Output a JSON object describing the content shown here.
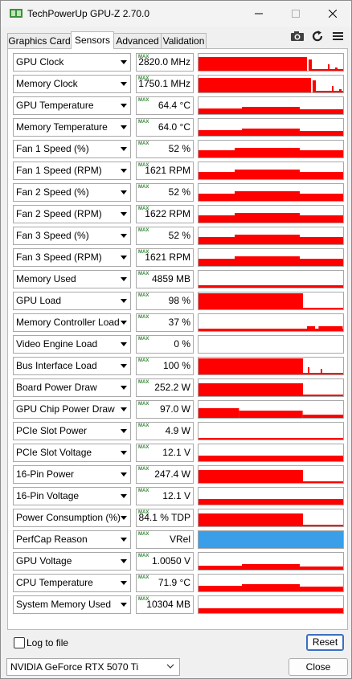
{
  "window": {
    "title": "TechPowerUp GPU-Z 2.70.0",
    "controls": {
      "minimize": "minimize-icon",
      "maximize": "maximize-icon",
      "close": "close-icon"
    }
  },
  "tabs": [
    {
      "label": "Graphics Card",
      "active": false
    },
    {
      "label": "Sensors",
      "active": true
    },
    {
      "label": "Advanced",
      "active": false
    },
    {
      "label": "Validation",
      "active": false
    }
  ],
  "toolbar": {
    "icons": [
      "camera-icon",
      "refresh-icon",
      "menu-icon"
    ]
  },
  "graph_color": "#ff0000",
  "perfcap_color": "#3a9ee8",
  "max_tag": "MAX",
  "sensors": [
    {
      "label": "GPU Clock",
      "value": "2820.0 MHz"
    },
    {
      "label": "Memory Clock",
      "value": "1750.1 MHz"
    },
    {
      "label": "GPU Temperature",
      "value": "64.4 °C"
    },
    {
      "label": "Memory Temperature",
      "value": "64.0 °C"
    },
    {
      "label": "Fan 1 Speed (%)",
      "value": "52 %"
    },
    {
      "label": "Fan 1 Speed (RPM)",
      "value": "1621 RPM"
    },
    {
      "label": "Fan 2 Speed (%)",
      "value": "52 %"
    },
    {
      "label": "Fan 2 Speed (RPM)",
      "value": "1622 RPM"
    },
    {
      "label": "Fan 3 Speed (%)",
      "value": "52 %"
    },
    {
      "label": "Fan 3 Speed (RPM)",
      "value": "1621 RPM"
    },
    {
      "label": "Memory Used",
      "value": "4859 MB"
    },
    {
      "label": "GPU Load",
      "value": "98 %"
    },
    {
      "label": "Memory Controller Load",
      "value": "37 %"
    },
    {
      "label": "Video Engine Load",
      "value": "0 %"
    },
    {
      "label": "Bus Interface Load",
      "value": "100 %"
    },
    {
      "label": "Board Power Draw",
      "value": "252.2 W"
    },
    {
      "label": "GPU Chip Power Draw",
      "value": "97.0 W"
    },
    {
      "label": "PCIe Slot Power",
      "value": "4.9 W"
    },
    {
      "label": "PCIe Slot Voltage",
      "value": "12.1 V"
    },
    {
      "label": "16-Pin Power",
      "value": "247.4 W"
    },
    {
      "label": "16-Pin Voltage",
      "value": "12.1 V"
    },
    {
      "label": "Power Consumption (%)",
      "value": "84.1 % TDP"
    },
    {
      "label": "PerfCap Reason",
      "value": "VRel"
    },
    {
      "label": "GPU Voltage",
      "value": "1.0050 V"
    },
    {
      "label": "CPU Temperature",
      "value": "71.9 °C"
    },
    {
      "label": "System Memory Used",
      "value": "10304 MB"
    }
  ],
  "log_to_file": {
    "label": "Log to file",
    "checked": false
  },
  "reset_label": "Reset",
  "device": {
    "selected": "NVIDIA GeForce RTX 5070 Ti"
  },
  "close_label": "Close"
}
